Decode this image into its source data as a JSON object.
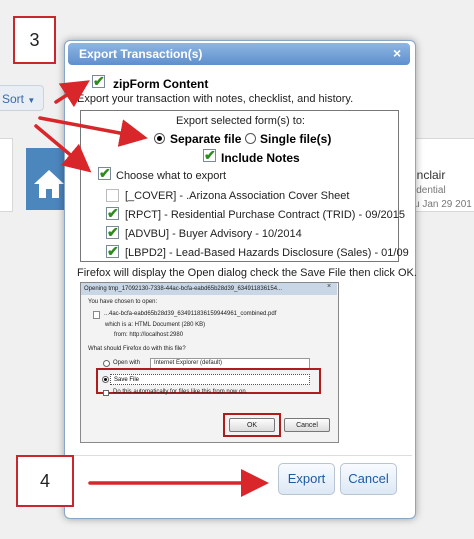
{
  "background": {
    "sort_label": "Sort",
    "card_name": "inclair",
    "card_type": "idential",
    "card_date": "u Jan 29 201"
  },
  "dialog": {
    "title": "Export Transaction(s)",
    "close_glyph": "×",
    "zipform_label": "zipForm Content",
    "zipform_desc": "Export your transaction with notes, checklist, and history.",
    "export_selected_label": "Export selected form(s) to:",
    "radio_separate": "Separate file",
    "radio_single": "Single file(s)",
    "include_notes": "Include Notes",
    "choose_label": "Choose what to export",
    "items": [
      {
        "label": "[_COVER] - .Arizona Association Cover Sheet",
        "checked": false
      },
      {
        "label": "[RPCT] - Residential Purchase Contract (TRID) - 09/2015",
        "checked": true
      },
      {
        "label": "[ADVBU] - Buyer Advisory - 10/2014",
        "checked": true
      },
      {
        "label": "[LBPD2] - Lead-Based Hazards Disclosure (Sales) - 01/09",
        "checked": true
      }
    ],
    "firefox_note": "Firefox will display the Open dialog check the Save File then click OK.",
    "export_button": "Export",
    "cancel_button": "Cancel"
  },
  "firefox_dialog": {
    "title": "Opening tmp_17092130-7338-44ac-bcfa-eabd65b28d39_634911836154...",
    "close_glyph": "×",
    "intro": "You have chosen to open:",
    "file_name": "...4ac-bcfa-eabd65b28d39_634911836159944961_combined.pdf",
    "which_is": "which is a:  HTML Document (280 KB)",
    "from": "from:  http://localhost:2980",
    "question": "What should Firefox do with this file?",
    "open_with": "Open with",
    "open_with_app": "Internet Explorer (default)",
    "save_file": "Save File",
    "auto_label": "Do this automatically for files like this from now on.",
    "ok_button": "OK",
    "cancel_button": "Cancel"
  },
  "callouts": {
    "step3": "3",
    "step4": "4"
  },
  "colors": {
    "accent": "#c8282c",
    "title_bar": "#5f8fcd",
    "check_green": "#2e8b1e"
  }
}
